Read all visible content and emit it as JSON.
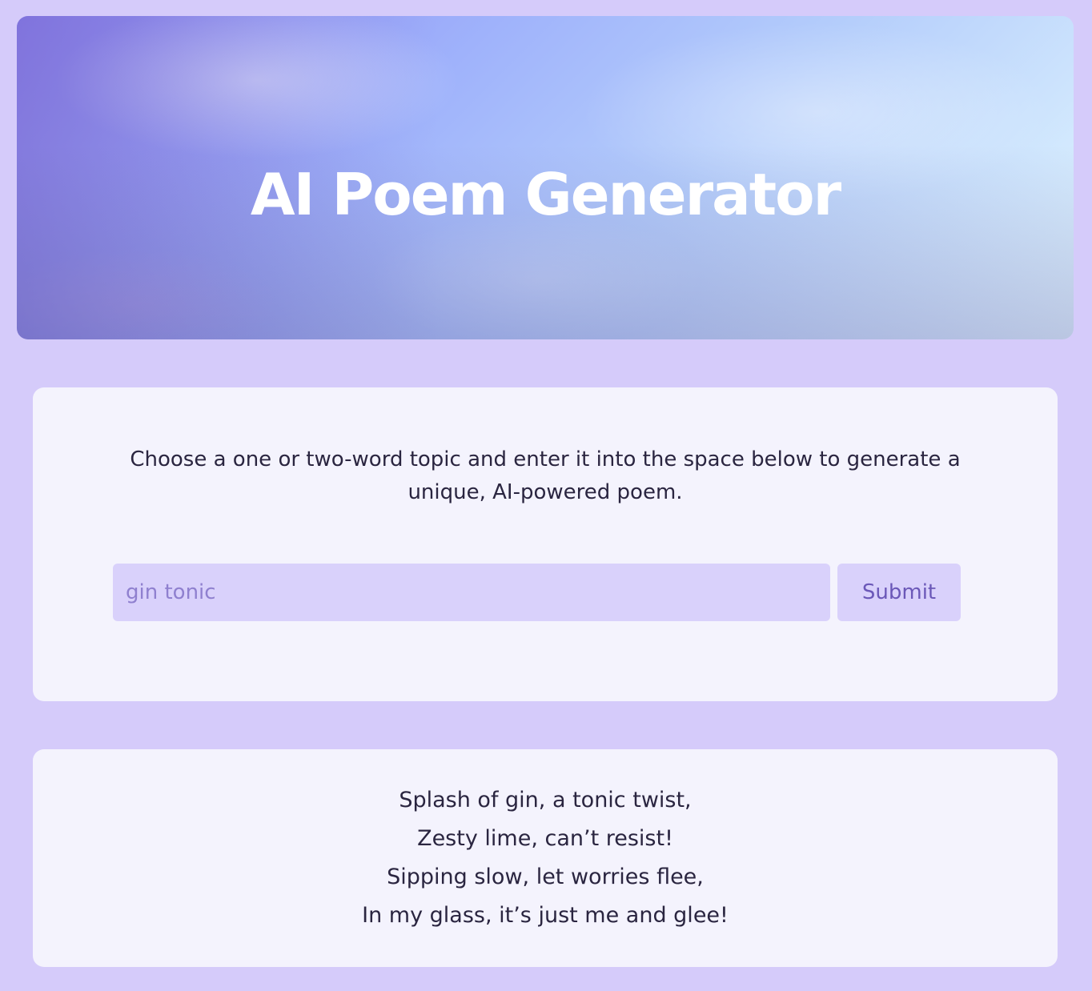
{
  "header": {
    "title": "AI Poem Generator"
  },
  "form": {
    "instructions": "Choose a one or two-word topic and enter it into the space below to generate a unique, AI-powered poem.",
    "topic_placeholder": "gin tonic",
    "submit_label": "Submit"
  },
  "poem": {
    "lines": [
      "Splash of gin, a tonic twist,",
      "Zesty lime, can’t resist!",
      "Sipping slow, let worries flee,",
      "In my glass, it’s just me and glee!"
    ]
  },
  "colors": {
    "page_background": "#d5cbfa",
    "card_background": "#f4f3fd",
    "input_background": "#d9d1fb",
    "button_text": "#6b58b8",
    "placeholder_text": "#8f80cf"
  }
}
